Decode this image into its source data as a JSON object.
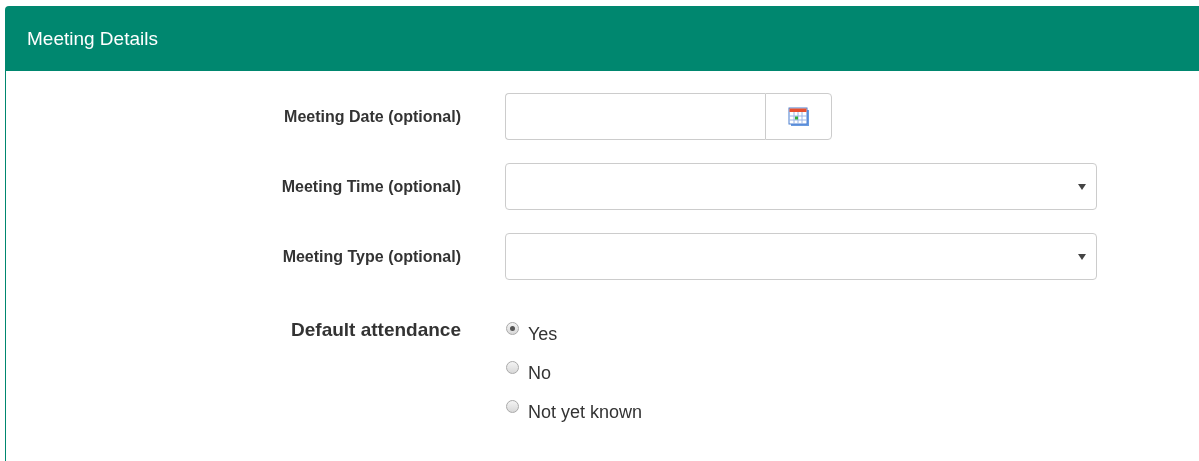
{
  "panel": {
    "title": "Meeting Details"
  },
  "fields": [
    {
      "kind": "date",
      "label": "Meeting Date (optional)"
    },
    {
      "kind": "select",
      "label": "Meeting Time (optional)"
    },
    {
      "kind": "select",
      "label": "Meeting Type (optional)"
    },
    {
      "kind": "radio",
      "label": "Default attendance",
      "options": [
        {
          "label": "Yes",
          "selected": true
        },
        {
          "label": "No",
          "selected": false
        },
        {
          "label": "Not yet known",
          "selected": false
        }
      ]
    }
  ]
}
